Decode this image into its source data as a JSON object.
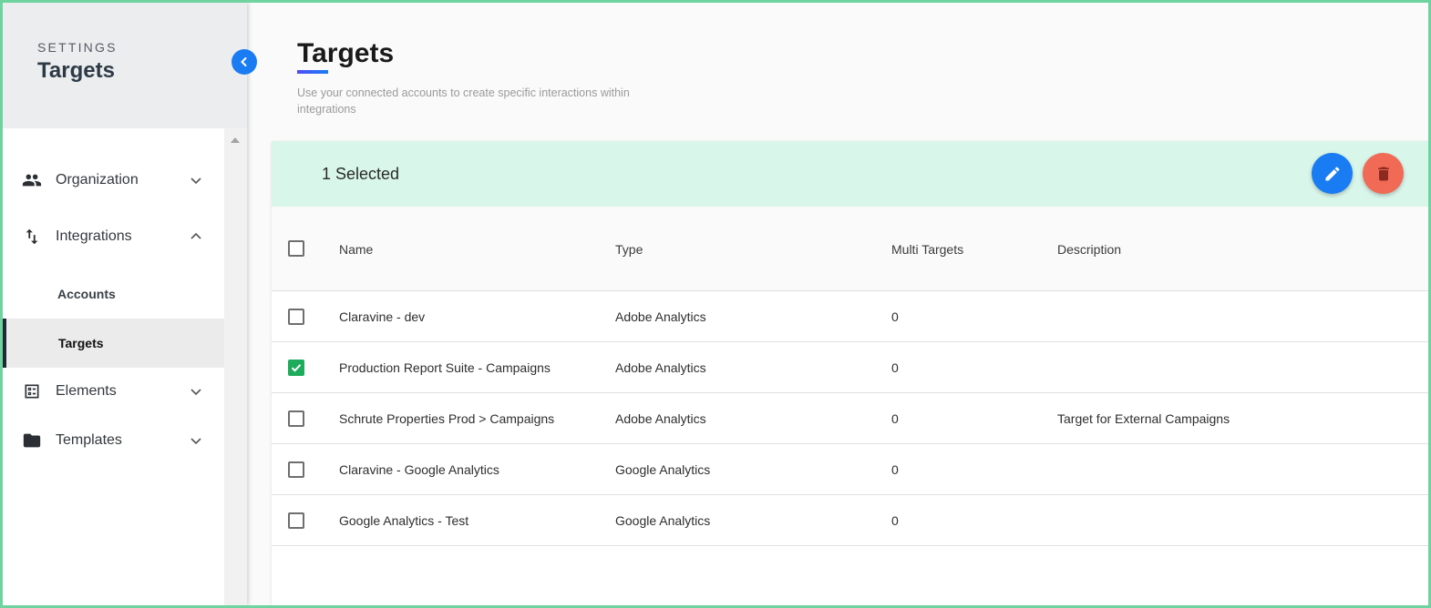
{
  "sidebar": {
    "settings_label": "SETTINGS",
    "title": "Targets",
    "items": [
      {
        "label": "Organization",
        "icon": "people-icon",
        "expanded": false
      },
      {
        "label": "Integrations",
        "icon": "swap-vertical-icon",
        "expanded": true,
        "children": [
          {
            "label": "Accounts",
            "active": false
          },
          {
            "label": "Targets",
            "active": true
          }
        ]
      },
      {
        "label": "Elements",
        "icon": "list-box-icon",
        "expanded": false
      },
      {
        "label": "Templates",
        "icon": "folder-icon",
        "expanded": false
      }
    ]
  },
  "main": {
    "title": "Targets",
    "subtitle": "Use your connected accounts to create specific interactions within integrations",
    "selection": {
      "text": "1 Selected",
      "edit_icon": "pencil-icon",
      "delete_icon": "trash-icon"
    },
    "table": {
      "columns": [
        "Name",
        "Type",
        "Multi Targets",
        "Description"
      ],
      "rows": [
        {
          "name": "Claravine - dev",
          "type": "Adobe Analytics",
          "multi": "0",
          "description": "",
          "checked": false
        },
        {
          "name": "Production Report Suite - Campaigns",
          "type": "Adobe Analytics",
          "multi": "0",
          "description": "",
          "checked": true
        },
        {
          "name": "Schrute Properties Prod > Campaigns",
          "type": "Adobe Analytics",
          "multi": "0",
          "description": "Target for External Campaigns",
          "checked": false
        },
        {
          "name": "Claravine - Google Analytics",
          "type": "Google Analytics",
          "multi": "0",
          "description": "",
          "checked": false
        },
        {
          "name": "Google Analytics - Test",
          "type": "Google Analytics",
          "multi": "0",
          "description": "",
          "checked": false
        }
      ]
    }
  },
  "colors": {
    "accent": "#1a7cf2",
    "selection_bg": "#d9f6ea",
    "delete": "#f06a55",
    "checked": "#1eab5c"
  }
}
